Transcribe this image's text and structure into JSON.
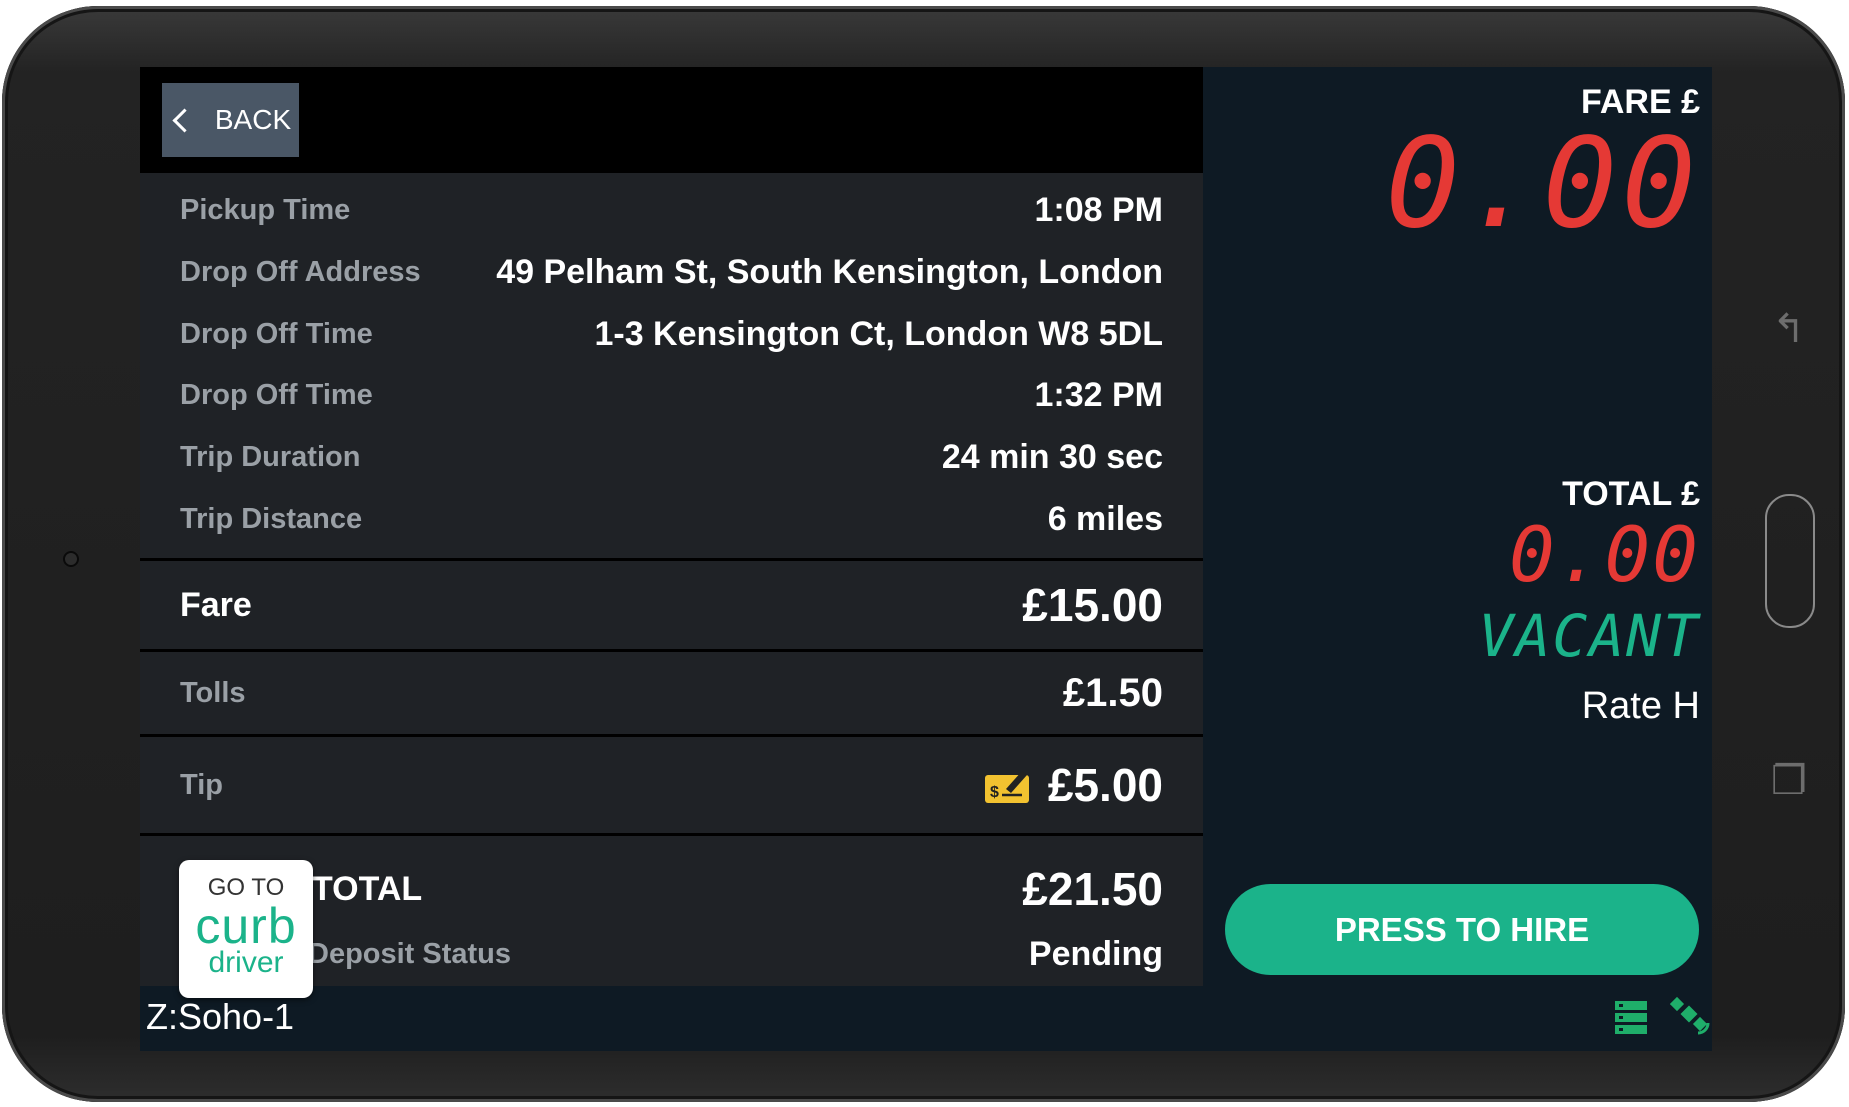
{
  "toolbar": {
    "back_label": "BACK"
  },
  "trip_details": [
    {
      "label": "Pickup Time",
      "value": "1:08 PM"
    },
    {
      "label": "Drop Off Address",
      "value": "49 Pelham St, South Kensington, London"
    },
    {
      "label": "Drop Off Time",
      "value": "1-3 Kensington Ct, London W8 5DL"
    },
    {
      "label": "Drop Off Time",
      "value": "1:32 PM"
    },
    {
      "label": "Trip Duration",
      "value": "24 min 30 sec"
    },
    {
      "label": "Trip Distance",
      "value": "6 miles"
    }
  ],
  "fare": {
    "label": "Fare",
    "value": "£15.00"
  },
  "tolls": {
    "label": "Tolls",
    "value": "£1.50"
  },
  "tip": {
    "label": "Tip",
    "value": "£5.00",
    "icon": "cheque-icon"
  },
  "total": {
    "label": "TOTAL",
    "value": "£21.50"
  },
  "deposit": {
    "label": "Deposit Status",
    "value": "Pending"
  },
  "curb_badge": {
    "line1": "GO TO",
    "brand": "curb",
    "line3": "driver"
  },
  "zone": "Z:Soho-1",
  "meter": {
    "fare_label": "FARE £",
    "fare_value": "0.00",
    "total_label": "TOTAL £",
    "total_value": "0.00",
    "status": "VACANT",
    "rate": "Rate H"
  },
  "hire_button": "PRESS TO HIRE",
  "colors": {
    "accent": "#1bb38a",
    "lcd_red": "#e53935",
    "screen_bg": "#0e1a24",
    "panel_bg": "#1f2226"
  }
}
